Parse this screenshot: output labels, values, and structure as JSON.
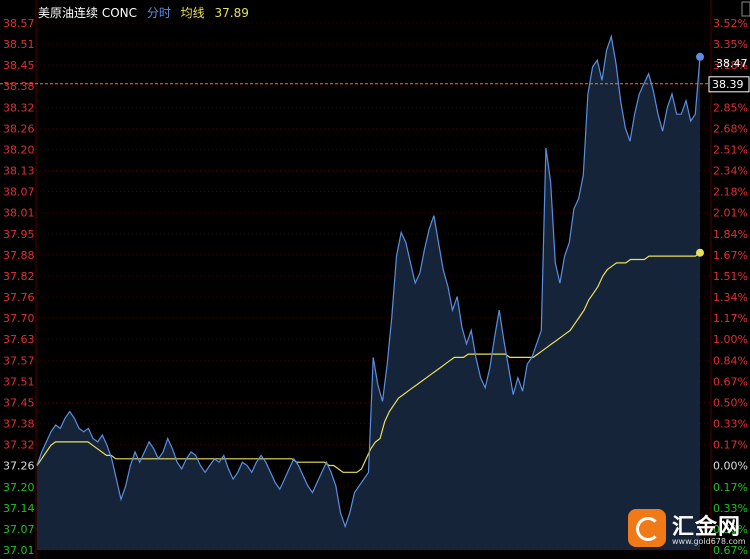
{
  "colors": {
    "background": "#000000",
    "grid": "#3a0000",
    "price_line": "#5a8fe0",
    "area_fill": "#16243a",
    "avg_line": "#e8e05a",
    "tick_red": "#e03030",
    "tick_green": "#20c020",
    "tick_white": "#dddddd",
    "ref_line": "#e08030"
  },
  "legend": {
    "instrument": "美原油连续 CONC",
    "series_label": "分时",
    "avg_label": "均线",
    "avg_value": "37.89"
  },
  "current_price": {
    "label": "38.39",
    "value": 38.39
  },
  "last_price_label": "38.47",
  "watermark": {
    "name": "汇金网",
    "url": "www.gold678.com"
  },
  "chart_data": {
    "type": "line",
    "ylim": [
      37.01,
      38.57
    ],
    "base_price": 37.26,
    "y_ticks_left": [
      "38.57",
      "38.51",
      "38.45",
      "38.38",
      "38.32",
      "38.26",
      "38.20",
      "38.13",
      "38.07",
      "38.01",
      "37.95",
      "37.88",
      "37.82",
      "37.76",
      "37.70",
      "37.63",
      "37.57",
      "37.51",
      "37.45",
      "37.38",
      "37.32",
      "37.26",
      "37.20",
      "37.14",
      "37.07",
      "37.01"
    ],
    "y_ticks_right": [
      "3.52%",
      "3.35%",
      "3.18%",
      "3.01%",
      "2.85%",
      "2.68%",
      "2.51%",
      "2.34%",
      "2.18%",
      "2.01%",
      "1.84%",
      "1.67%",
      "1.51%",
      "1.34%",
      "1.17%",
      "1.00%",
      "0.84%",
      "0.67%",
      "0.50%",
      "0.33%",
      "0.17%",
      "0.00%",
      "0.17%",
      "0.33%",
      "0.50%",
      "0.67%"
    ],
    "series": [
      {
        "name": "分时",
        "values": [
          37.26,
          37.3,
          37.33,
          37.36,
          37.38,
          37.37,
          37.4,
          37.42,
          37.4,
          37.37,
          37.36,
          37.37,
          37.34,
          37.33,
          37.35,
          37.32,
          37.28,
          37.22,
          37.16,
          37.2,
          37.26,
          37.3,
          37.27,
          37.3,
          37.33,
          37.31,
          37.28,
          37.3,
          37.34,
          37.31,
          37.27,
          37.25,
          37.28,
          37.3,
          37.29,
          37.26,
          37.24,
          37.26,
          37.28,
          37.27,
          37.29,
          37.25,
          37.22,
          37.24,
          37.27,
          37.26,
          37.24,
          37.27,
          37.29,
          37.27,
          37.24,
          37.21,
          37.19,
          37.22,
          37.25,
          37.28,
          37.26,
          37.23,
          37.2,
          37.18,
          37.21,
          37.24,
          37.27,
          37.24,
          37.2,
          37.12,
          37.08,
          37.12,
          37.18,
          37.2,
          37.22,
          37.24,
          37.58,
          37.5,
          37.45,
          37.56,
          37.7,
          37.88,
          37.95,
          37.92,
          37.86,
          37.8,
          37.83,
          37.9,
          37.96,
          38.0,
          37.92,
          37.84,
          37.79,
          37.72,
          37.76,
          37.67,
          37.62,
          37.66,
          37.58,
          37.52,
          37.49,
          37.55,
          37.64,
          37.72,
          37.63,
          37.55,
          37.47,
          37.52,
          37.48,
          37.56,
          37.58,
          37.62,
          37.66,
          38.2,
          38.1,
          37.86,
          37.8,
          37.88,
          37.92,
          38.02,
          38.05,
          38.12,
          38.36,
          38.44,
          38.46,
          38.4,
          38.49,
          38.53,
          38.45,
          38.34,
          38.26,
          38.22,
          38.3,
          38.36,
          38.39,
          38.42,
          38.37,
          38.3,
          38.25,
          38.32,
          38.36,
          38.3,
          38.3,
          38.34,
          38.28,
          38.3,
          38.47
        ]
      },
      {
        "name": "均线",
        "values": [
          37.26,
          37.28,
          37.3,
          37.32,
          37.33,
          37.33,
          37.33,
          37.33,
          37.33,
          37.33,
          37.33,
          37.33,
          37.32,
          37.31,
          37.3,
          37.29,
          37.29,
          37.28,
          37.28,
          37.28,
          37.28,
          37.28,
          37.28,
          37.28,
          37.28,
          37.28,
          37.28,
          37.28,
          37.28,
          37.28,
          37.28,
          37.28,
          37.28,
          37.28,
          37.28,
          37.28,
          37.28,
          37.28,
          37.28,
          37.28,
          37.28,
          37.28,
          37.28,
          37.28,
          37.28,
          37.28,
          37.28,
          37.28,
          37.28,
          37.28,
          37.28,
          37.28,
          37.28,
          37.28,
          37.28,
          37.28,
          37.27,
          37.27,
          37.27,
          37.27,
          37.27,
          37.27,
          37.27,
          37.26,
          37.26,
          37.25,
          37.24,
          37.24,
          37.24,
          37.24,
          37.25,
          37.28,
          37.31,
          37.33,
          37.34,
          37.39,
          37.42,
          37.44,
          37.46,
          37.47,
          37.48,
          37.49,
          37.5,
          37.51,
          37.52,
          37.53,
          37.54,
          37.55,
          37.56,
          37.57,
          37.58,
          37.58,
          37.58,
          37.59,
          37.59,
          37.59,
          37.59,
          37.59,
          37.59,
          37.59,
          37.59,
          37.59,
          37.58,
          37.58,
          37.58,
          37.58,
          37.58,
          37.58,
          37.59,
          37.6,
          37.61,
          37.62,
          37.63,
          37.64,
          37.65,
          37.66,
          37.68,
          37.7,
          37.72,
          37.75,
          37.77,
          37.79,
          37.82,
          37.84,
          37.85,
          37.86,
          37.86,
          37.86,
          37.87,
          37.87,
          37.87,
          37.87,
          37.88,
          37.88,
          37.88,
          37.88,
          37.88,
          37.88,
          37.88,
          37.88,
          37.88,
          37.88,
          37.88,
          37.89
        ]
      }
    ]
  }
}
